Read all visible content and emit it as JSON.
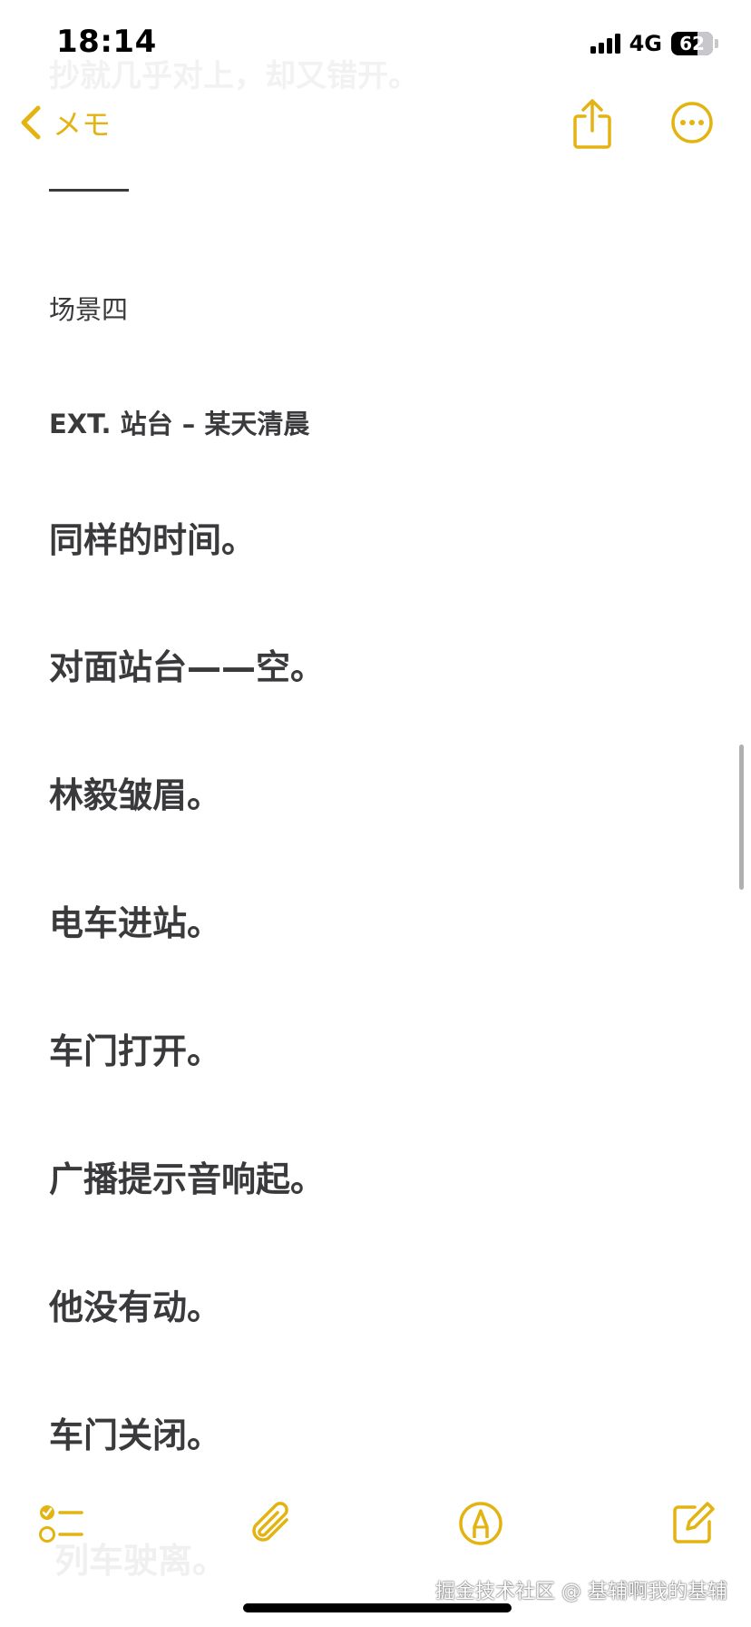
{
  "status_bar": {
    "time": "18:14",
    "network": "4G",
    "battery": "62",
    "battery_level": 0.62
  },
  "nav": {
    "back_label": "メモ",
    "ghost_text": "抄就几乎对上，却又错开。"
  },
  "note": {
    "scene_title": "场景四",
    "scene_heading": "EXT. 站台 – 某天清晨",
    "lines": [
      "同样的时间。",
      "对面站台——空。",
      "林毅皱眉。",
      "电车进站。",
      "车门打开。",
      "广播提示音响起。",
      "他没有动。",
      "车门关闭。"
    ],
    "ghost_bottom": "列车驶离。"
  },
  "toolbar": {
    "checklist_icon": "checklist-icon",
    "attachment_icon": "paperclip-icon",
    "markup_icon": "markup-pen-icon",
    "compose_icon": "compose-icon"
  },
  "watermark": "掘金技术社区 @ 基辅啊我的基辅",
  "colors": {
    "accent": "#e3b411",
    "text": "#3a3a3c"
  }
}
